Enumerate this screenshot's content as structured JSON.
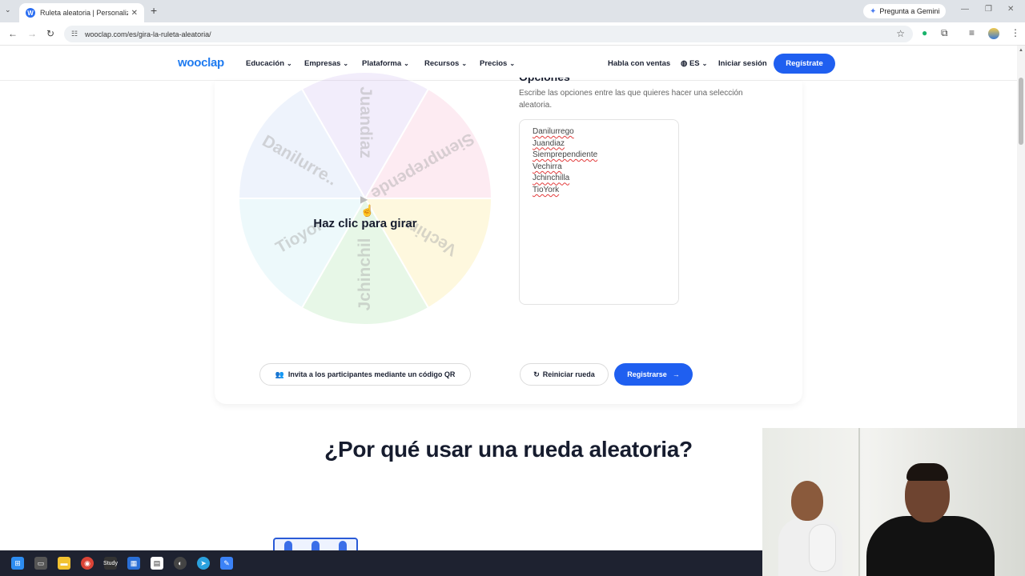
{
  "browser": {
    "tab_title": "Ruleta aleatoria | Personaliza y c",
    "favicon_letter": "W",
    "url": "wooclap.com/es/gira-la-ruleta-aleatoria/",
    "gemini_label": "Pregunta a Gemini"
  },
  "site": {
    "logo": "wooclap",
    "nav": [
      "Educación",
      "Empresas",
      "Plataforma",
      "Recursos",
      "Precios"
    ],
    "sales": "Habla con ventas",
    "lang": "ES",
    "login": "Iniciar sesión",
    "signup": "Regístrate"
  },
  "wheel": {
    "segments": [
      "Juandiaz",
      "Siemprepende",
      "Vechirr",
      "Jchinchil",
      "Tioyor",
      "Danilurre.."
    ],
    "colors": [
      "#d9c9f4",
      "#fbc4d8",
      "#fdeb9a",
      "#b7e8b5",
      "#c8eef5",
      "#cdddf7"
    ],
    "spin_label": "Haz clic para girar"
  },
  "options": {
    "title": "Opciones",
    "description": "Escribe las opciones entre las que quieres hacer una selección aleatoria.",
    "items": [
      "Danilurrego",
      "Juandiaz",
      "Siemprependiente",
      "Vechirra",
      "Jchinchilla",
      "TioYork"
    ]
  },
  "actions": {
    "qr": "Invita a los participantes mediante un código QR",
    "reset": "Reiniciar rueda",
    "register": "Registrarse"
  },
  "section": {
    "heading": "¿Por qué usar una rueda aleatoria?"
  },
  "taskbar": {
    "study_label": "Study"
  },
  "colors": {
    "brand": "#1f7bf0",
    "button": "#1f5ff0",
    "heading": "#161c2e"
  }
}
